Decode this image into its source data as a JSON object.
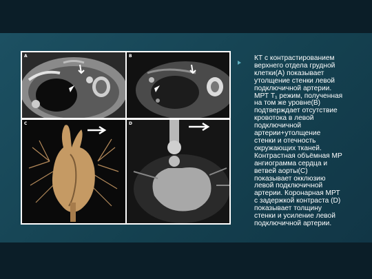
{
  "figure": {
    "panel_labels": [
      "A",
      "B",
      "C",
      "D"
    ]
  },
  "text": {
    "body": "КТ с контрастированием\nверхнего отдела грудной\nклетки(А) показывает\nутолщение стенки левой\nподключичной артерии.\nМРТ T₁ режим, полученная\nна том же уровне(В)\nподтверждает отсутствие\nкровотока в левой\nподключичной\nартерии+утолщение\nстенки и отечность\nокружающих тканей.\nКонтрастная объёмная МР\nангиограмма сердца и\nветвей аорты(С)\nпоказывает окклюзию\nлевой подключичной\nартерии. Коронарная МРТ\nс задержкой контраста (D)\nпоказывает толщину\nстенки и усиление левой\nподключичной артерии."
  },
  "colors": {
    "background": "#14404f",
    "dark_band": "#0b1e28",
    "bullet": "#5fb0c0",
    "text": "#ffffff"
  }
}
